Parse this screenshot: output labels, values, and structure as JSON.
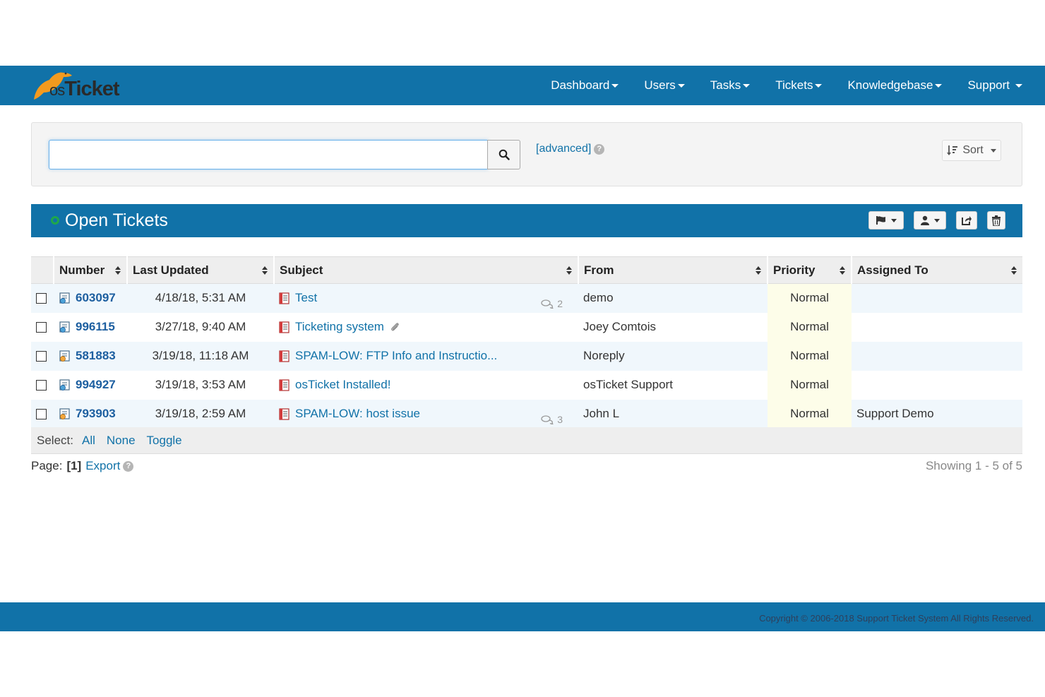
{
  "brand": {
    "logo_os": "os",
    "logo_ticket": "Ticket"
  },
  "nav": [
    {
      "label": "Dashboard"
    },
    {
      "label": "Users"
    },
    {
      "label": "Tasks"
    },
    {
      "label": "Tickets"
    },
    {
      "label": "Knowledgebase"
    },
    {
      "label": "Support"
    }
  ],
  "search": {
    "value": "",
    "placeholder": "",
    "advanced_label": "[advanced]",
    "sort_label": "Sort"
  },
  "queue": {
    "title": "Open Tickets"
  },
  "table": {
    "headers": [
      "Number",
      "Last Updated",
      "Subject",
      "From",
      "Priority",
      "Assigned To"
    ],
    "rows": [
      {
        "number": "603097",
        "updated": "4/18/18, 5:31 AM",
        "subject": "Test",
        "threads": "2",
        "from": "demo",
        "priority": "Normal",
        "assigned": ""
      },
      {
        "number": "996115",
        "updated": "3/27/18, 9:40 AM",
        "subject": "Ticketing system",
        "threads": "",
        "from": "Joey Comtois",
        "priority": "Normal",
        "assigned": ""
      },
      {
        "number": "581883",
        "updated": "3/19/18, 11:18 AM",
        "subject": "SPAM-LOW: FTP Info and Instructio...",
        "threads": "",
        "from": "Noreply",
        "priority": "Normal",
        "assigned": ""
      },
      {
        "number": "994927",
        "updated": "3/19/18, 3:53 AM",
        "subject": "osTicket Installed!",
        "threads": "",
        "from": "osTicket Support",
        "priority": "Normal",
        "assigned": ""
      },
      {
        "number": "793903",
        "updated": "3/19/18, 2:59 AM",
        "subject": "SPAM-LOW: host issue",
        "threads": "3",
        "from": "John L",
        "priority": "Normal",
        "assigned": "Support Demo"
      }
    ]
  },
  "select_bar": {
    "label": "Select:",
    "all": "All",
    "none": "None",
    "toggle": "Toggle"
  },
  "paging": {
    "page_label": "Page:",
    "current": "[1]",
    "export": "Export",
    "showing": "Showing 1 - 5 of 5"
  },
  "footer": {
    "copyright": "Copyright © 2006-2018 Support Ticket System All Rights Reserved."
  },
  "colors": {
    "brand_blue": "#1172a8",
    "priority_bg": "#fdfde9",
    "refresh_green": "#1fa84a"
  }
}
